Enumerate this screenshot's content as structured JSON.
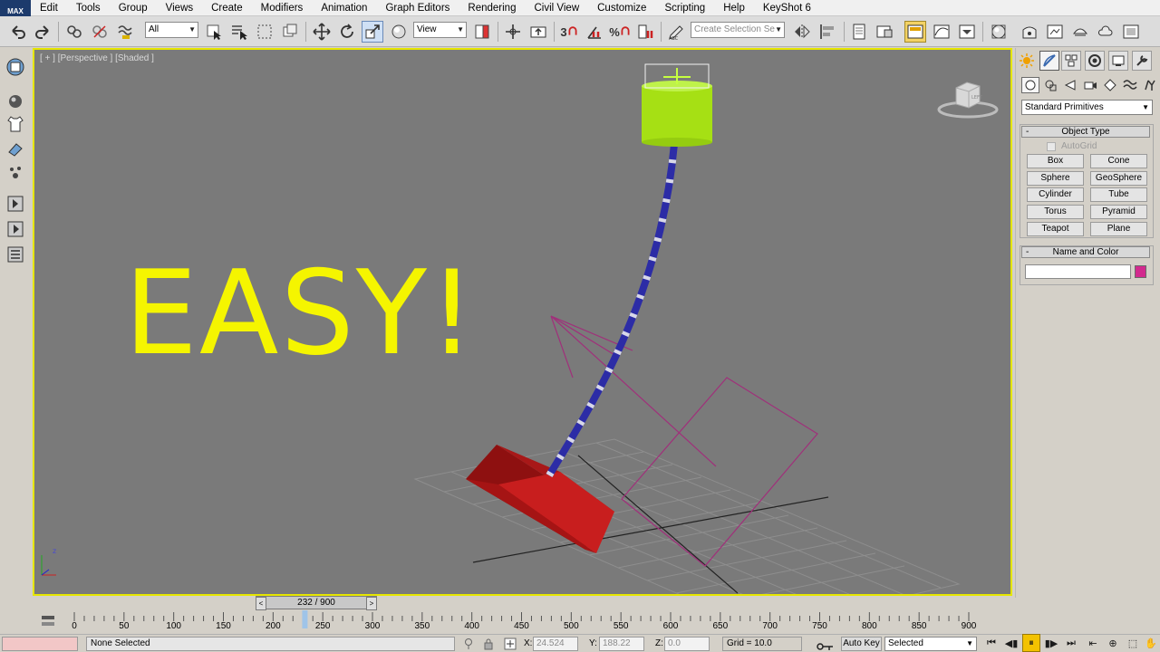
{
  "app": {
    "logo_text": "MAX"
  },
  "menu": [
    "Edit",
    "Tools",
    "Group",
    "Views",
    "Create",
    "Modifiers",
    "Animation",
    "Graph Editors",
    "Rendering",
    "Civil View",
    "Customize",
    "Scripting",
    "Help",
    "KeyShot 6"
  ],
  "toolbar": {
    "filter_value": "All",
    "coord_system": "View",
    "selection_set_placeholder": "Create Selection Se",
    "snap_labels": [
      "3",
      "%"
    ]
  },
  "viewport": {
    "label": "[ + ] [Perspective ] [Shaded ]",
    "overlay_text": "EASY!",
    "overlay_color": "#f5f500",
    "border_color": "#e6e600",
    "bg_color": "#7a7a7a",
    "viewcube_label": "LEFT",
    "axis_z": "z"
  },
  "command_panel": {
    "category": "Standard Primitives",
    "object_type_title": "Object Type",
    "autogrid_label": "AutoGrid",
    "primitives": [
      "Box",
      "Cone",
      "Sphere",
      "GeoSphere",
      "Cylinder",
      "Tube",
      "Torus",
      "Pyramid",
      "Teapot",
      "Plane"
    ],
    "name_color_title": "Name and Color",
    "name_value": "",
    "object_color": "#d22a8e"
  },
  "time_slider": {
    "label": "232 / 900",
    "prev": "<",
    "next": ">"
  },
  "trackbar": {
    "current_frame": 232,
    "labels": [
      "0",
      "50",
      "100",
      "150",
      "200",
      "250",
      "300",
      "350",
      "400",
      "450",
      "500",
      "550",
      "600",
      "650",
      "700",
      "750",
      "800",
      "850",
      "900"
    ]
  },
  "status": {
    "selection": "None Selected",
    "x_label": "X:",
    "x_value": "24.524",
    "y_label": "Y:",
    "y_value": "188.22",
    "z_label": "Z:",
    "z_value": "0.0",
    "grid": "Grid = 10.0",
    "autokey": "Auto Key",
    "key_filter": "Selected"
  }
}
